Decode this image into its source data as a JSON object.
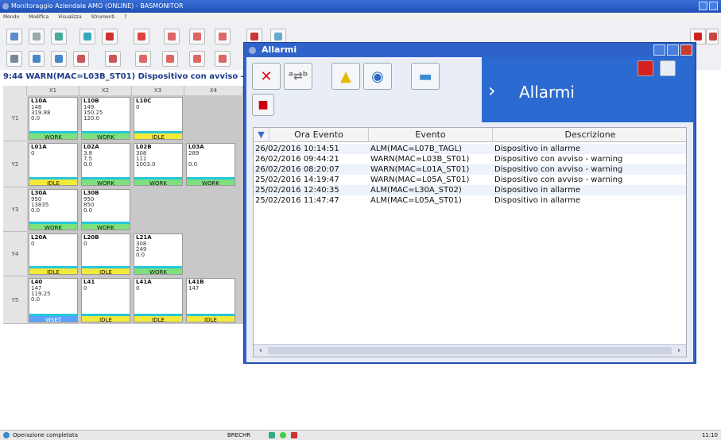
{
  "window": {
    "title": "Monitoraggio Aziendale AMO (ONLINE) - BASMONITOR"
  },
  "menu": [
    "Mondo",
    "Modifica",
    "Visualizza",
    "Strumenti",
    "?"
  ],
  "ticker": "9:44 WARN(MAC=L03B_ST01) Dispositivo con avviso - w",
  "grid": {
    "columns": [
      "X1",
      "X2",
      "X3",
      "X4"
    ],
    "rows": [
      "Y1",
      "Y2",
      "Y3",
      "Y4",
      "Y5"
    ],
    "cells": [
      {
        "id": "L10A",
        "vals": "148\n319.88\n0.0",
        "status": "WORK"
      },
      {
        "id": "L10B",
        "vals": "149\n150.25\n120.0",
        "status": "WORK"
      },
      {
        "id": "L10C",
        "vals": "0",
        "status": "IDLE"
      },
      {
        "id": "L01A",
        "vals": "0",
        "status": "IDLE"
      },
      {
        "id": "L02A",
        "vals": "3.8\n7.5\n0.0",
        "status": "WORK"
      },
      {
        "id": "L02B",
        "vals": "308\n111\n1003.0",
        "status": "WORK"
      },
      {
        "id": "L03A",
        "vals": "289\n\n0.0",
        "status": "WORK"
      },
      {
        "id": "L30A",
        "vals": "950\n13835\n0.0",
        "status": "WORK"
      },
      {
        "id": "L30B",
        "vals": "950\n850\n0.0",
        "status": "WORK"
      },
      {
        "id": "L20A",
        "vals": "0",
        "status": "IDLE"
      },
      {
        "id": "L20B",
        "vals": "0",
        "status": "IDLE"
      },
      {
        "id": "L21A",
        "vals": "308\n249\n0.0",
        "status": "WORK"
      },
      {
        "id": "L40",
        "vals": "147\n119.25\n0.0",
        "status": "WSET"
      },
      {
        "id": "L41",
        "vals": "0",
        "status": "IDLE"
      },
      {
        "id": "L41A",
        "vals": "0",
        "status": "IDLE"
      },
      {
        "id": "L41B",
        "vals": "147",
        "status": "IDLE"
      }
    ]
  },
  "alarm_window": {
    "title": "Allarmi",
    "banner": "Allarmi",
    "toolbar": [
      "close",
      "sort",
      "clear",
      "find",
      "print",
      "save"
    ],
    "columns": [
      "Ora Evento",
      "Evento",
      "Descrizione"
    ],
    "rows": [
      {
        "time": "26/02/2016 10:14:51",
        "event": "ALM(MAC=L07B_TAGL)",
        "desc": "Dispositivo in allarme"
      },
      {
        "time": "26/02/2016 09:44:21",
        "event": "WARN(MAC=L03B_ST01)",
        "desc": "Dispositivo con avviso - warning"
      },
      {
        "time": "26/02/2016 08:20:07",
        "event": "WARN(MAC=L01A_ST01)",
        "desc": "Dispositivo con avviso - warning"
      },
      {
        "time": "25/02/2016 14:19:47",
        "event": "WARN(MAC=L05A_ST01)",
        "desc": "Dispositivo con avviso - warning"
      },
      {
        "time": "25/02/2016 12:40:35",
        "event": "ALM(MAC=L30A_ST02)",
        "desc": "Dispositivo in allarme"
      },
      {
        "time": "25/02/2016 11:47:47",
        "event": "ALM(MAC=L05A_ST01)",
        "desc": "Dispositivo in allarme"
      }
    ]
  },
  "statusbar": {
    "message": "Operazione completata",
    "user": "BRECHR",
    "clock": "11:10"
  },
  "colors": {
    "title": "#1f4fb5",
    "work": "#7ee07e",
    "idle": "#f5e93a",
    "banner": "#2b6ad0"
  }
}
